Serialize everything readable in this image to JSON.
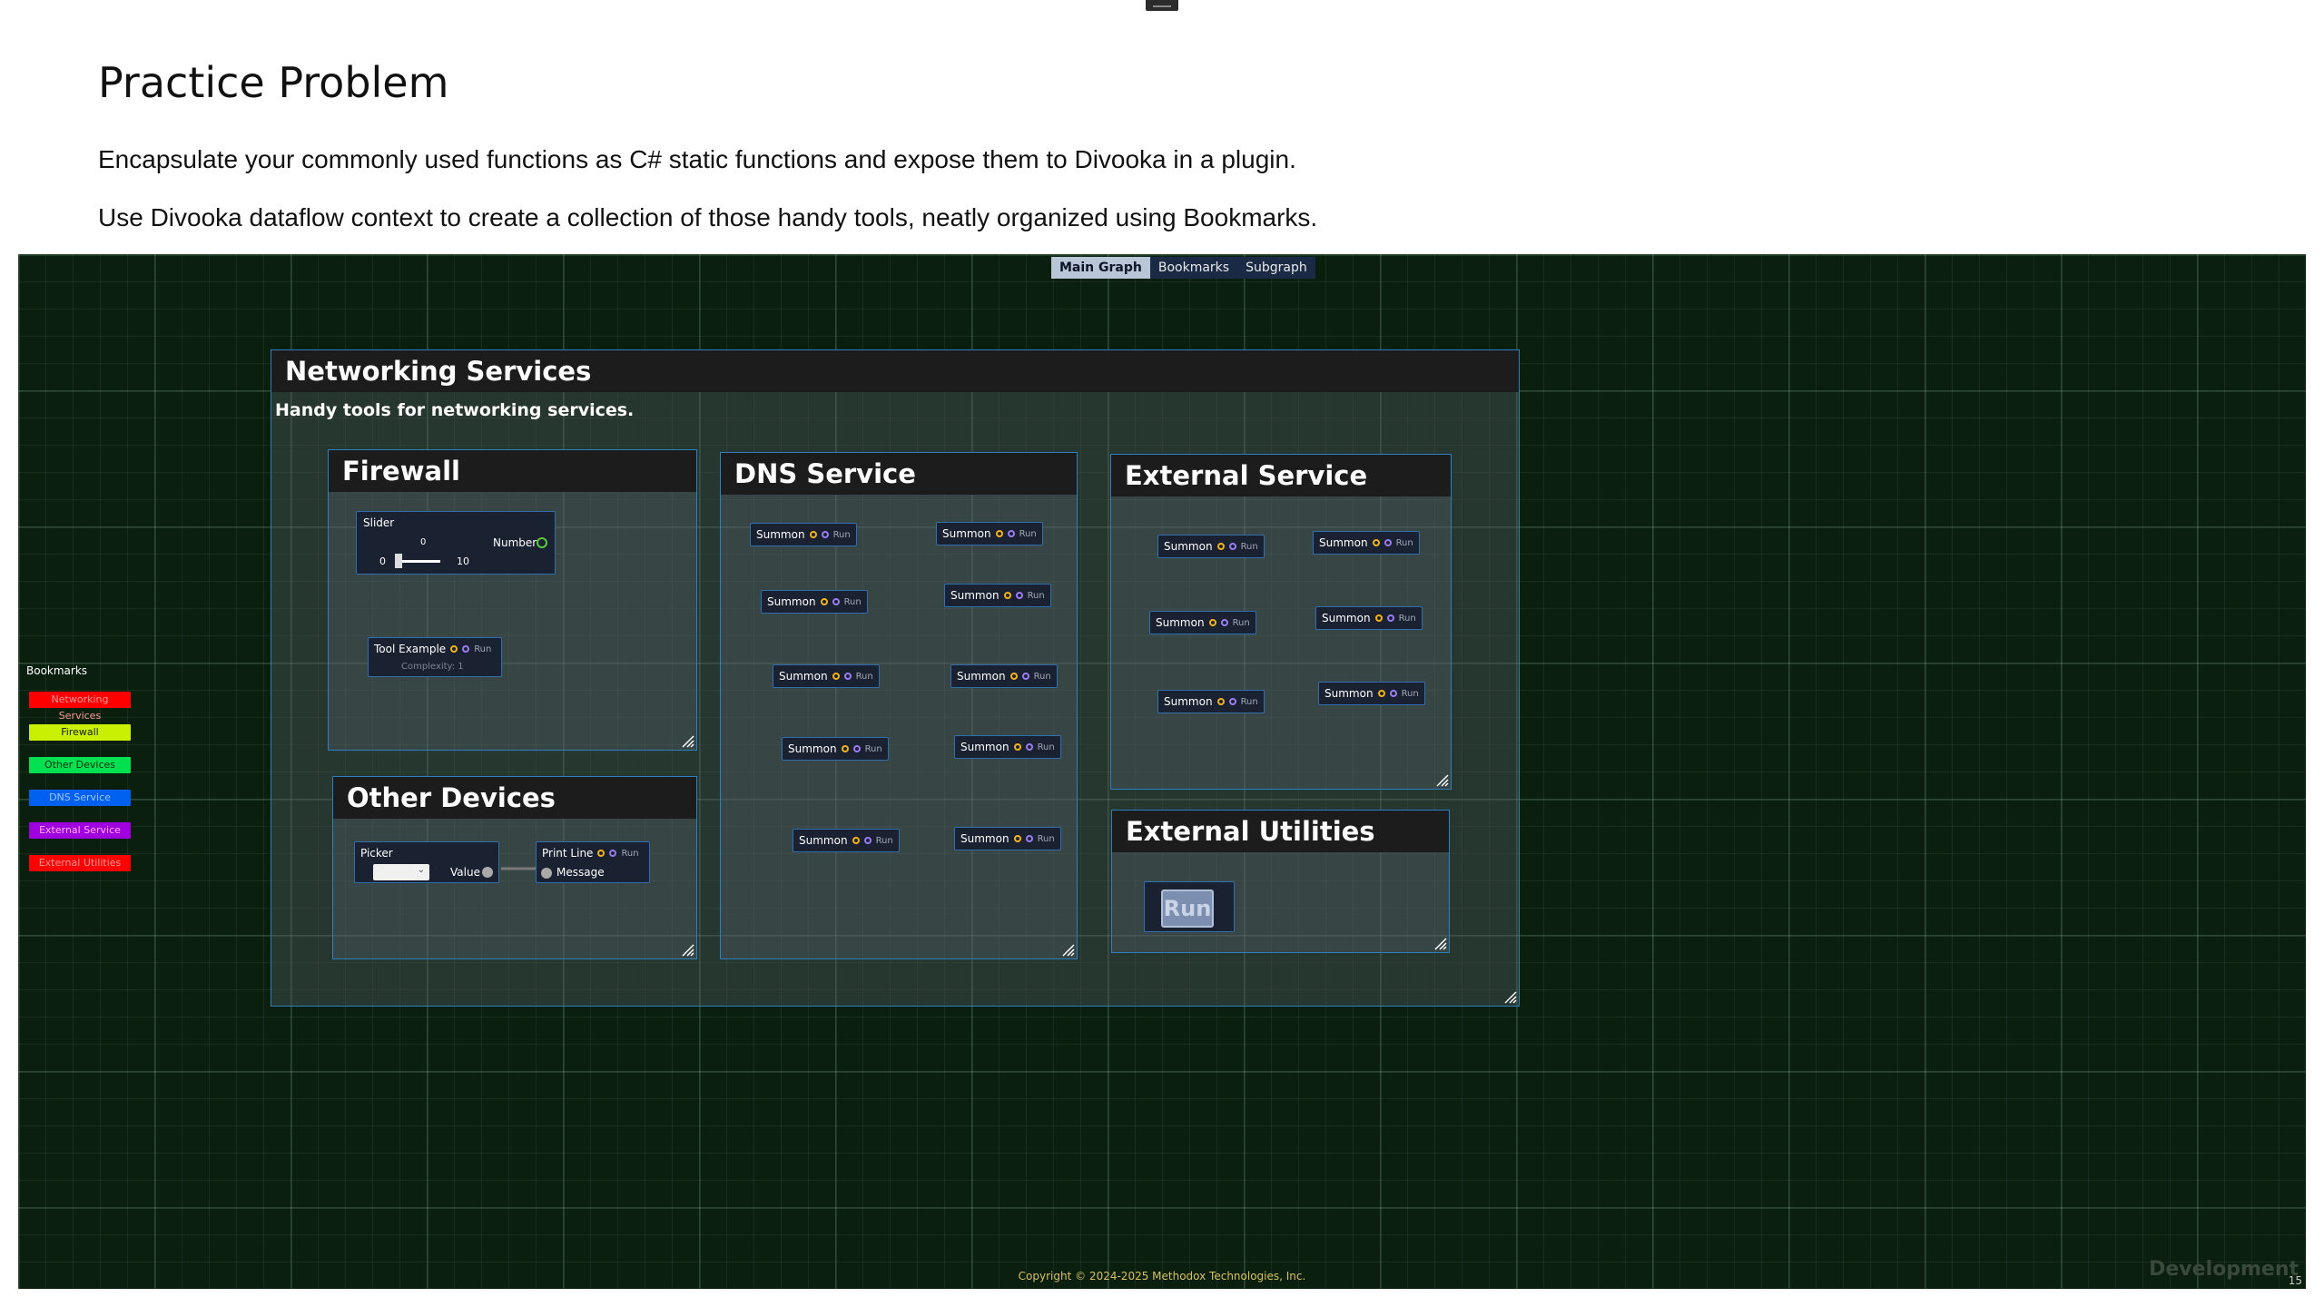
{
  "slide": {
    "title": "Practice Problem",
    "line1": "Encapsulate your commonly used functions as C# static functions and expose them to Divooka in a plugin.",
    "line2": "Use Divooka dataflow context to create a collection of those handy tools, neatly organized using Bookmarks."
  },
  "tabs": [
    "Main Graph",
    "Bookmarks",
    "Subgraph"
  ],
  "bookmarks": {
    "title": "Bookmarks",
    "items": [
      {
        "label": "Networking Services",
        "color": "#ff0000",
        "text_color": "#ff9999"
      },
      {
        "label": "Firewall",
        "color": "#c8f000",
        "text_color": "#1a1a00"
      },
      {
        "label": "Other Devices",
        "color": "#00e050",
        "text_color": "#003010"
      },
      {
        "label": "DNS Service",
        "color": "#0060f0",
        "text_color": "#a0c8ff"
      },
      {
        "label": "External Service",
        "color": "#a000e0",
        "text_color": "#ffb0ff"
      },
      {
        "label": "External Utilities",
        "color": "#ff0000",
        "text_color": "#ff9999"
      }
    ]
  },
  "networking": {
    "title": "Networking Services",
    "description": "Handy tools for networking services."
  },
  "firewall": {
    "title": "Firewall",
    "slider": {
      "label": "Slider",
      "value": "0",
      "min": "0",
      "max": "10",
      "output": "Number"
    },
    "tool": {
      "label": "Tool Example",
      "run": "Run",
      "complexity": "Complexity: 1"
    }
  },
  "other_devices": {
    "title": "Other Devices",
    "picker": {
      "label": "Picker",
      "output": "Value"
    },
    "print": {
      "label": "Print Line",
      "run": "Run",
      "input": "Message"
    }
  },
  "dns": {
    "title": "DNS Service",
    "node_label": "Summon",
    "run": "Run"
  },
  "external_service": {
    "title": "External Service",
    "node_label": "Summon",
    "run": "Run"
  },
  "external_utilities": {
    "title": "External Utilities",
    "run": "Run"
  },
  "footer": {
    "copyright": "Copyright © 2024-2025 Methodox Technologies, Inc.",
    "watermark": "Development",
    "page": "15"
  }
}
